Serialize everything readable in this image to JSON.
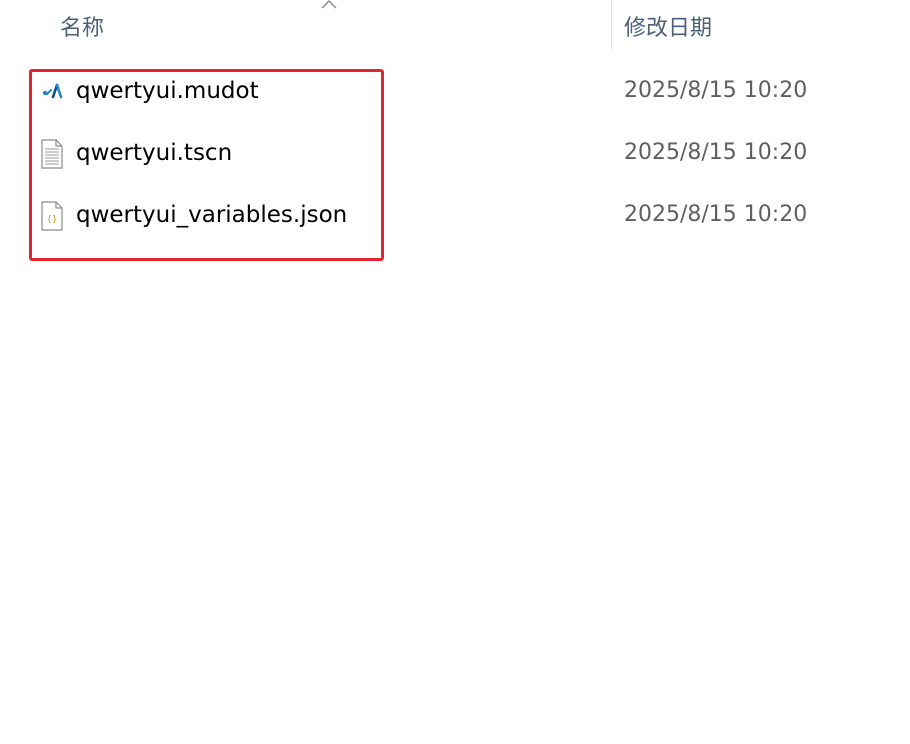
{
  "columns": {
    "name_label": "名称",
    "date_label": "修改日期"
  },
  "files": [
    {
      "name": "qwertyui.mudot",
      "modified": "2025/8/15 10:20",
      "icon": "mudot-file-icon"
    },
    {
      "name": "qwertyui.tscn",
      "modified": "2025/8/15 10:20",
      "icon": "text-file-icon"
    },
    {
      "name": "qwertyui_variables.json",
      "modified": "2025/8/15 10:20",
      "icon": "json-file-icon"
    }
  ],
  "colors": {
    "highlight": "#e0262f",
    "header_text": "#4c607a",
    "date_text": "#5f5f5f"
  }
}
